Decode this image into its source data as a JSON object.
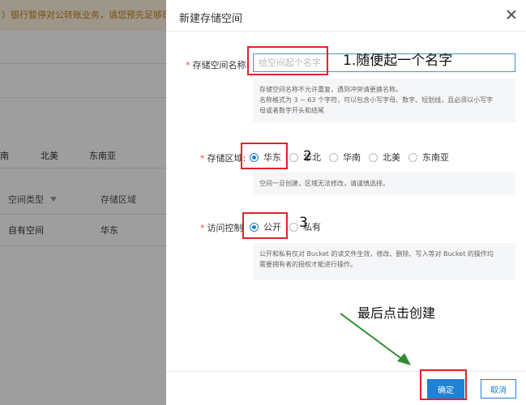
{
  "background": {
    "notice": "）银行暂停对公转账业务，请您预先足够现金",
    "region_tabs": [
      "南",
      "北美",
      "东南亚"
    ],
    "table": {
      "headers": [
        "空间类型",
        "存储区域"
      ],
      "rows": [
        [
          "自有空间",
          "华东"
        ]
      ]
    }
  },
  "dialog": {
    "title": "新建存储空间",
    "name_field": {
      "label": "存储空间名称:",
      "placeholder": "给空间起个名字",
      "value": "",
      "hint_lines": [
        "存储空间名称不允许重复，遇到冲突请更换名称。",
        "名称格式为 3 ~ 63 个字符，可以包含小写字母、数字、短划线，且必须以小写字",
        "母或者数字开头和结尾"
      ]
    },
    "region": {
      "label": "存储区域:",
      "options": [
        "华东",
        "华北",
        "华南",
        "北美",
        "东南亚"
      ],
      "selected": "华东",
      "hint": "空间一旦创建，区域无法修改，请谨慎选择。"
    },
    "access": {
      "label": "访问控制",
      "options": [
        "公开",
        "私有"
      ],
      "selected": "公开",
      "hint_lines": [
        "公开和私有仅对 Bucket 的读文件生效，修改、删除、写入等对 Bucket 的操作均",
        "需要拥有者的授权才能进行操作。"
      ]
    },
    "confirm_label": "确定",
    "cancel_label": "取消"
  },
  "annotations": {
    "step1": "1.随便起一个名字",
    "step2": "2",
    "step3": "3",
    "final": "最后点击创建"
  },
  "colors": {
    "accent": "#1e82d6",
    "highlight_box": "#e0232b",
    "arrow": "#2e8b2e",
    "notice_bg": "#fdf3df"
  }
}
